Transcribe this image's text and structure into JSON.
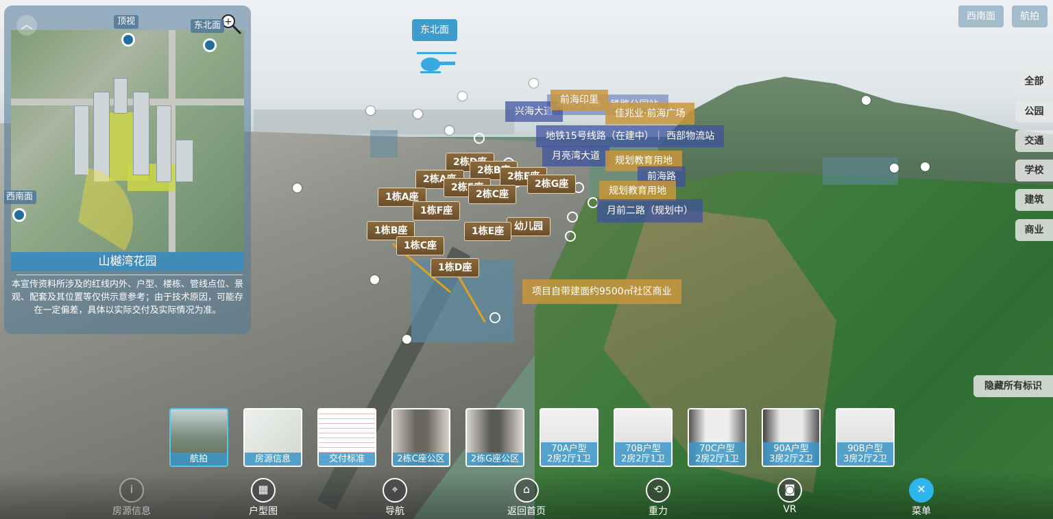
{
  "minimap": {
    "title": "山樾湾花园",
    "description": "本宣传资料所涉及的红线内外、户型、楼栋、管线点位、景观、配套及其位置等仅供示意参考；由于技术原因，可能存在一定偏差，具体以实际交付及实际情况为准。",
    "view_top": "顶视",
    "view_northeast": "东北面",
    "view_southwest": "西南面"
  },
  "scene": {
    "view_label": "东北面"
  },
  "top_buttons": {
    "southwest": "西南面",
    "aerial": "航拍"
  },
  "side_filters": [
    "全部",
    "公园",
    "交通",
    "学校",
    "建筑",
    "商业"
  ],
  "hide_all": "隐藏所有标识",
  "building_tags": {
    "b1a": "1栋A座",
    "b1b": "1栋B座",
    "b1c": "1栋C座",
    "b1d": "1栋D座",
    "b1e": "1栋E座",
    "b1f": "1栋F座",
    "b2a": "2栋A座",
    "b2b": "2栋B座",
    "b2c": "2栋C座",
    "b2d": "2栋D座",
    "b2e": "2栋E座",
    "b2f": "2栋F座",
    "b2g": "2栋G座",
    "kindergarten": "幼儿园"
  },
  "poi_tags": {
    "qianhai_yinli": "前海印里",
    "xinghai": "兴海大道",
    "metro5": "地铁5号线 | 铁路公园站",
    "zhuzhaoye": "佳兆业·前海广场",
    "metro15": "地铁15号线路（在建中）｜ 西部物流站",
    "yueliangwan": "月亮湾大道",
    "edu1": "规划教育用地",
    "qianhai_road": "前海路",
    "edu2": "规划教育用地",
    "yueqian2": "月前二路（规划中）",
    "commercial": "项目自带建面约9500㎡社区商业"
  },
  "thumbnails": [
    {
      "label": "航拍",
      "active": true
    },
    {
      "label": "房源信息",
      "active": false
    },
    {
      "label": "交付标准",
      "active": false
    },
    {
      "label": "2栋C座公区",
      "active": false
    },
    {
      "label": "2栋G座公区",
      "active": false
    },
    {
      "label": "70A户型\n2房2厅1卫",
      "active": false
    },
    {
      "label": "70B户型\n2房2厅1卫",
      "active": false
    },
    {
      "label": "70C户型\n2房2厅1卫",
      "active": false
    },
    {
      "label": "90A户型\n3房2厅2卫",
      "active": false
    },
    {
      "label": "90B户型\n3房2厅2卫",
      "active": false
    }
  ],
  "toolbar": {
    "listing": "房源信息",
    "floorplan": "户型图",
    "navigation": "导航",
    "home": "返回首页",
    "gravity": "重力",
    "vr": "VR",
    "menu": "菜单"
  },
  "colors": {
    "accent": "#2fb6ee",
    "tag_brown": "#7a5a33",
    "tag_blue": "#3c50a0",
    "tag_gold": "#c8963c"
  },
  "icons": {
    "collapse": "chevron-up-icon",
    "zoom": "magnifier-icon",
    "helicopter": "helicopter-icon"
  }
}
